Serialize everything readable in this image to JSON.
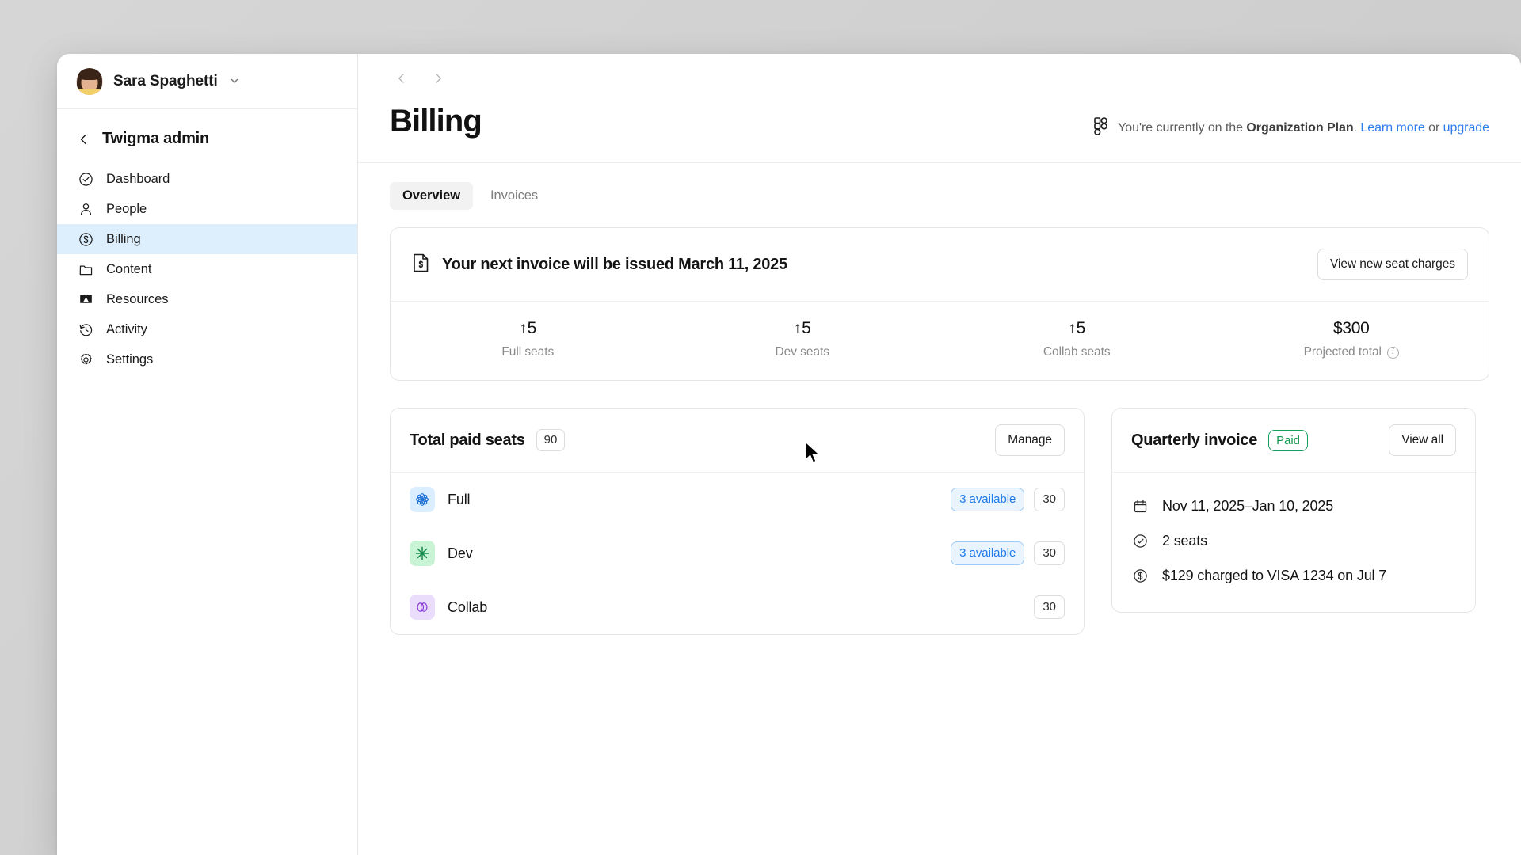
{
  "window": {
    "sidebar": {
      "user": {
        "name": "Sara Spaghetti",
        "avatar_icon": "user-photo-avatar",
        "chevron_icon": "chevron-down-icon"
      },
      "org": {
        "back_icon": "chevron-left-icon",
        "title": "Twigma admin"
      },
      "items": [
        {
          "label": "Dashboard",
          "icon": "check-circle-icon",
          "active": false
        },
        {
          "label": "People",
          "icon": "person-icon",
          "active": false
        },
        {
          "label": "Billing",
          "icon": "dollar-circle-icon",
          "active": true
        },
        {
          "label": "Content",
          "icon": "folder-icon",
          "active": false
        },
        {
          "label": "Resources",
          "icon": "book-icon",
          "active": false
        },
        {
          "label": "Activity",
          "icon": "clock-history-icon",
          "active": false
        },
        {
          "label": "Settings",
          "icon": "gear-icon",
          "active": false
        }
      ]
    },
    "topbar": {
      "back_icon": "chevron-left-icon",
      "forward_icon": "chevron-right-icon"
    },
    "page": {
      "title": "Billing",
      "plan_notice": {
        "logo_icon": "figma-logo-icon",
        "prefix": "You're currently on the ",
        "plan_name": "Organization Plan",
        "period": ". ",
        "link_learn": "Learn more",
        "conjunction": " or ",
        "link_upgrade": "upgrade"
      },
      "tabs": [
        {
          "label": "Overview",
          "active": true
        },
        {
          "label": "Invoices",
          "active": false
        }
      ]
    },
    "banner": {
      "icon": "invoice-document-icon",
      "title": "Your next invoice will be issued March 11, 2025",
      "action_label": "View new seat charges",
      "stats": [
        {
          "arrow": "↑",
          "value": "5",
          "label": "Full seats",
          "has_info": false
        },
        {
          "arrow": "↑",
          "value": "5",
          "label": "Dev seats",
          "has_info": false
        },
        {
          "arrow": "↑",
          "value": "5",
          "label": "Collab seats",
          "has_info": false
        },
        {
          "arrow": "",
          "value": "$300",
          "label": "Projected total",
          "has_info": true
        }
      ]
    },
    "seats_card": {
      "title": "Total paid seats",
      "total": "90",
      "manage_label": "Manage",
      "rows": [
        {
          "name": "Full",
          "icon": "full-seat-flower-icon",
          "available": "3 available",
          "count": "30"
        },
        {
          "name": "Dev",
          "icon": "dev-seat-asterisk-icon",
          "available": "3 available",
          "count": "30"
        },
        {
          "name": "Collab",
          "icon": "collab-seat-circles-icon",
          "available": "",
          "count": "30"
        }
      ]
    },
    "invoice_card": {
      "title": "Quarterly invoice",
      "status": "Paid",
      "view_all_label": "View all",
      "lines": [
        {
          "icon": "calendar-icon",
          "text": "Nov 11, 2025–Jan 10, 2025"
        },
        {
          "icon": "check-circle-icon",
          "text": "2 seats"
        },
        {
          "icon": "dollar-circle-icon",
          "text": "$129 charged to VISA 1234 on Jul 7"
        }
      ]
    }
  },
  "colors": {
    "accent_blue": "#2f7ded",
    "active_nav_bg": "#ddeefc",
    "paid_green": "#12994f",
    "full_seat_bg": "#dbeeff",
    "dev_seat_bg": "#c8f3d4",
    "collab_seat_bg": "#eadcfb",
    "desktop_bg": "#d2d2d2"
  }
}
